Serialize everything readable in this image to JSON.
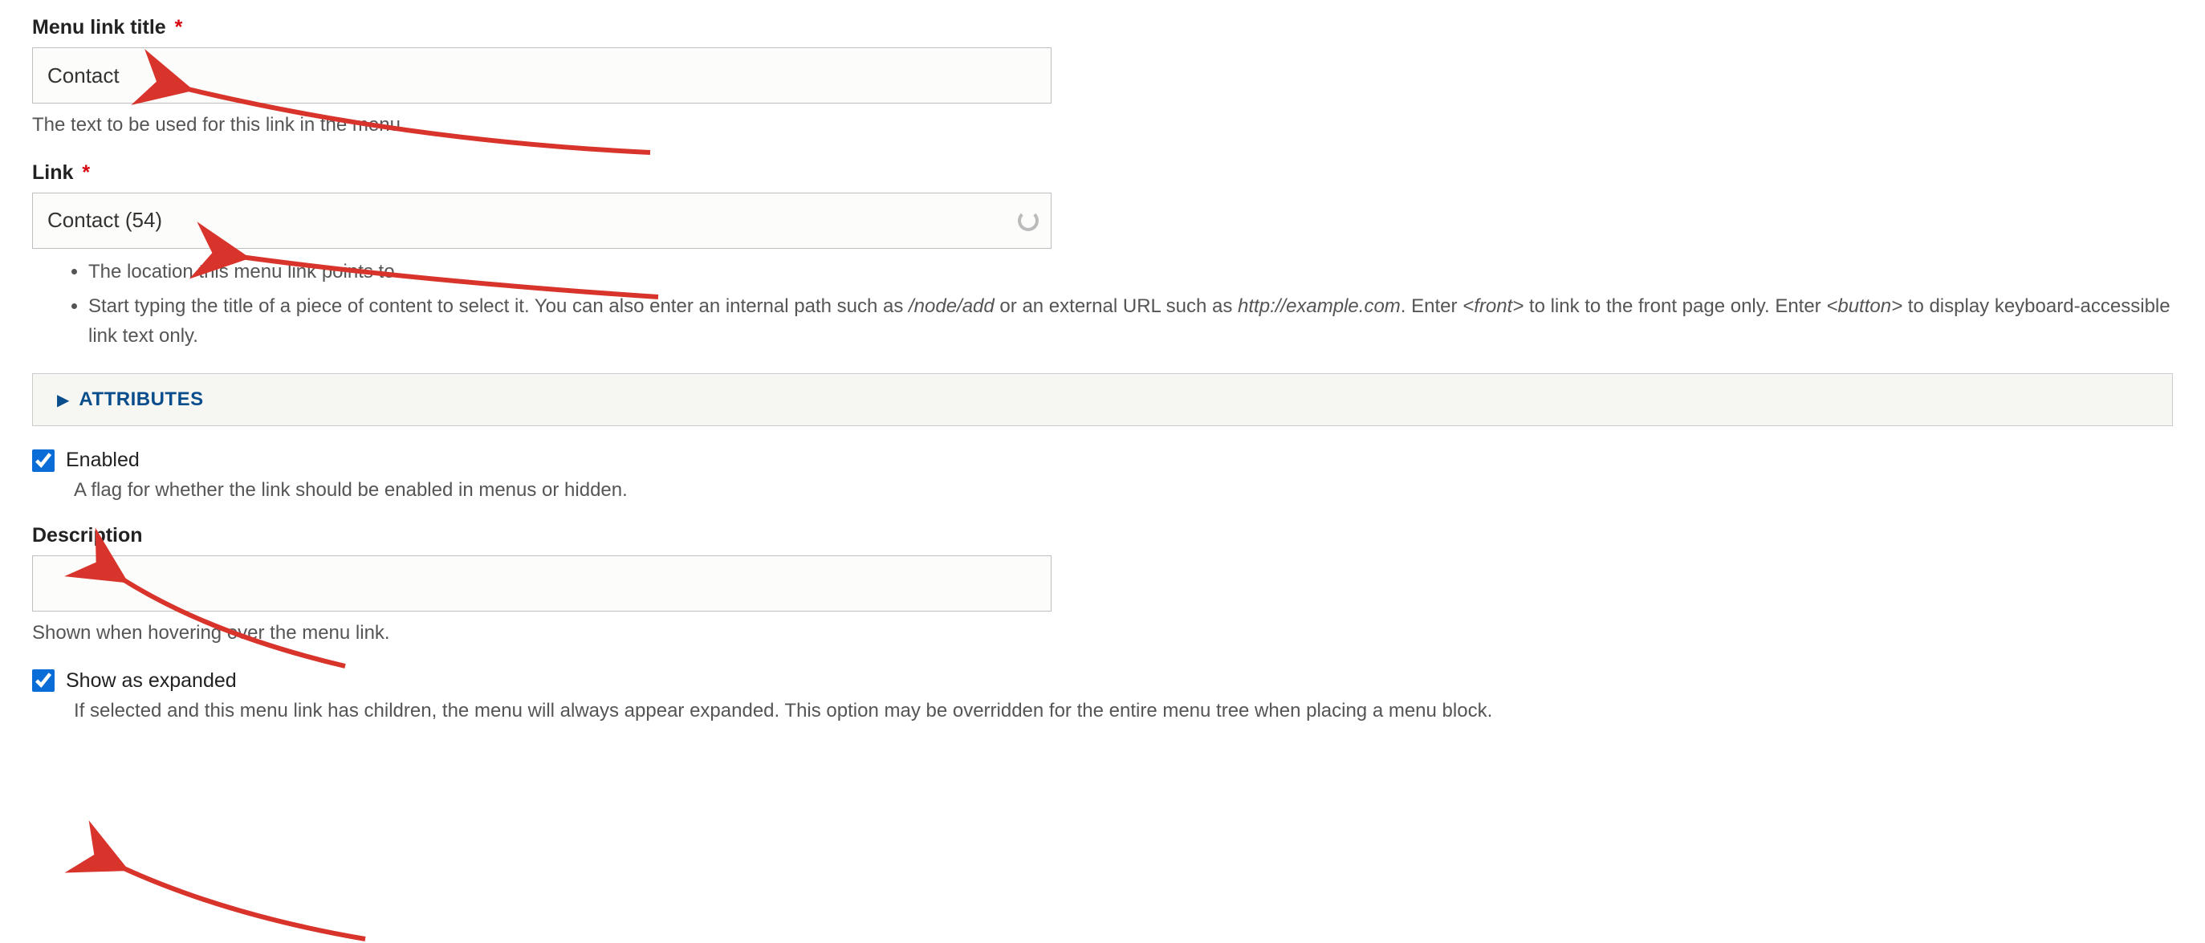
{
  "menu_link_title": {
    "label": "Menu link title",
    "required_marker": "*",
    "value": "Contact",
    "description": "The text to be used for this link in the menu."
  },
  "link": {
    "label": "Link",
    "required_marker": "*",
    "value": "Contact (54)",
    "desc_list_1": "The location this menu link points to.",
    "desc_list_2a": "Start typing the title of a piece of content to select it. You can also enter an internal path such as ",
    "desc_list_2_em1": "/node/add",
    "desc_list_2b": " or an external URL such as ",
    "desc_list_2_em2": "http://example.com",
    "desc_list_2c": ". Enter ",
    "desc_list_2_em3": "<front>",
    "desc_list_2d": " to link to the front page only. Enter ",
    "desc_list_2_em4": "<button>",
    "desc_list_2e": " to display keyboard-accessible link text only."
  },
  "attributes": {
    "title": "ATTRIBUTES"
  },
  "enabled": {
    "label": "Enabled",
    "checked": true,
    "description": "A flag for whether the link should be enabled in menus or hidden."
  },
  "description": {
    "label": "Description",
    "value": "",
    "help": "Shown when hovering over the menu link."
  },
  "expanded": {
    "label": "Show as expanded",
    "checked": true,
    "description": "If selected and this menu link has children, the menu will always appear expanded. This option may be overridden for the entire menu tree when placing a menu block."
  }
}
